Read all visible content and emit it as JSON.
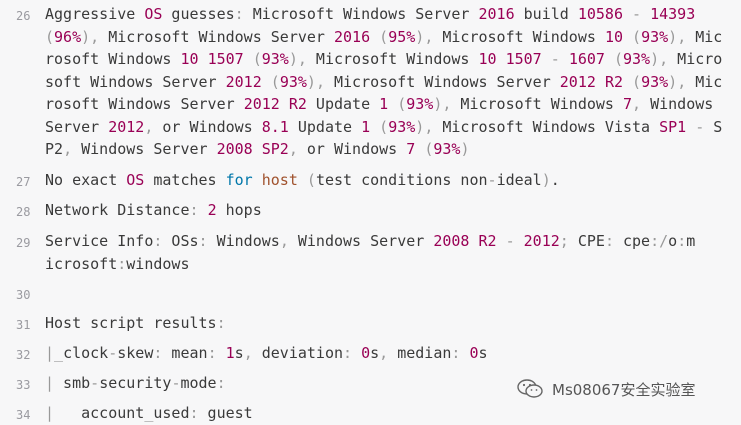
{
  "lines": [
    {
      "num": "26",
      "rows": [
        "Aggressive OS guesses: Microsoft Windows Server 2016 build 10586 - 14393",
        "(96%), Microsoft Windows Server 2016 (95%), Microsoft Windows 10 (93%), Mic",
        "rosoft Windows 10 1507 (93%), Microsoft Windows 10 1507 - 1607 (93%), Micro",
        "soft Windows Server 2012 (93%), Microsoft Windows Server 2012 R2 (93%), Mic",
        "rosoft Windows Server 2012 R2 Update 1 (93%), Microsoft Windows 7, Windows",
        "Server 2012, or Windows 8.1 Update 1 (93%), Microsoft Windows Vista SP1 - S",
        "P2, Windows Server 2008 SP2, or Windows 7 (93%)"
      ]
    },
    {
      "num": "27",
      "rows": [
        "No exact OS matches for host (test conditions non-ideal)."
      ]
    },
    {
      "num": "28",
      "rows": [
        "Network Distance: 2 hops"
      ]
    },
    {
      "num": "29",
      "rows": [
        "Service Info: OSs: Windows, Windows Server 2008 R2 - 2012; CPE: cpe:/o:m",
        "icrosoft:windows"
      ]
    },
    {
      "num": "30",
      "rows": [
        ""
      ]
    },
    {
      "num": "31",
      "rows": [
        "Host script results:"
      ]
    },
    {
      "num": "32",
      "rows": [
        "|_clock-skew: mean: 1s, deviation: 0s, median: 0s"
      ]
    },
    {
      "num": "33",
      "rows": [
        "| smb-security-mode:"
      ]
    },
    {
      "num": "34",
      "rows": [
        "|   account_used: guest"
      ]
    }
  ],
  "watermark": {
    "text": "Ms08067安全实验室",
    "icon": "wechat-icon"
  },
  "colors": {
    "number": "#990055",
    "keyword": "#0077aa",
    "string": "#a0522d",
    "punct": "#999999"
  }
}
